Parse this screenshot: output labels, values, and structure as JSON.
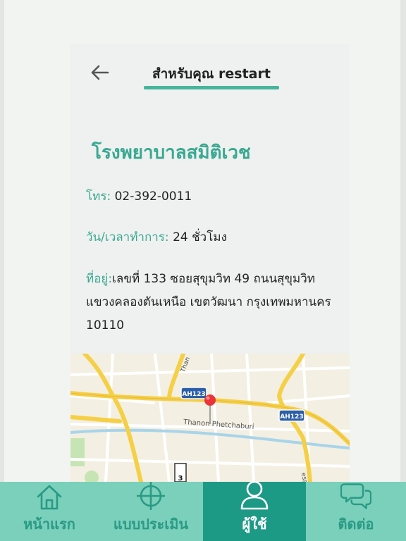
{
  "header": {
    "title": "สำหรับคุณ restart",
    "back_icon": "arrow-left-icon"
  },
  "hospital": {
    "name": "โรงพยาบาลสมิติเวช",
    "phone_label": "โทร:",
    "phone_value": "02-392-0011",
    "hours_label": "วัน/เวลาทำการ:",
    "hours_value": "24 ชั่วโมง",
    "address_label": "ที่อยู่:",
    "address_value": "เลขที่ 133 ซอยสุขุมวิท 49 ถนนสุขุมวิท แขวงคลองตันเหนือ เขตวัฒนา กรุงเทพมหานคร 10110"
  },
  "map": {
    "road_label": "Thanon Phetchaburi",
    "shield_1": "AH123",
    "shield_2": "AH123",
    "side_label_1": "Than",
    "side_label_2": "essway",
    "route_marker": "3",
    "pin_icon": "map-pin-icon",
    "colors": {
      "land": "#f3efe2",
      "major_road": "#f5cf45",
      "water": "#a8d4ea",
      "park": "#c7e4b4",
      "pin": "#e8343a"
    }
  },
  "tabs": [
    {
      "label": "หน้าแรก",
      "icon": "home-icon",
      "active": false
    },
    {
      "label": "แบบประเมิน",
      "icon": "crosshair-icon",
      "active": false
    },
    {
      "label": "ผู้ใช้",
      "icon": "user-icon",
      "active": true
    },
    {
      "label": "ติดต่อ",
      "icon": "chat-bubbles-icon",
      "active": false
    }
  ],
  "colors": {
    "accent": "#3aa892",
    "tabbar": "#7ad0bb",
    "tab_active": "#1d9a86"
  }
}
